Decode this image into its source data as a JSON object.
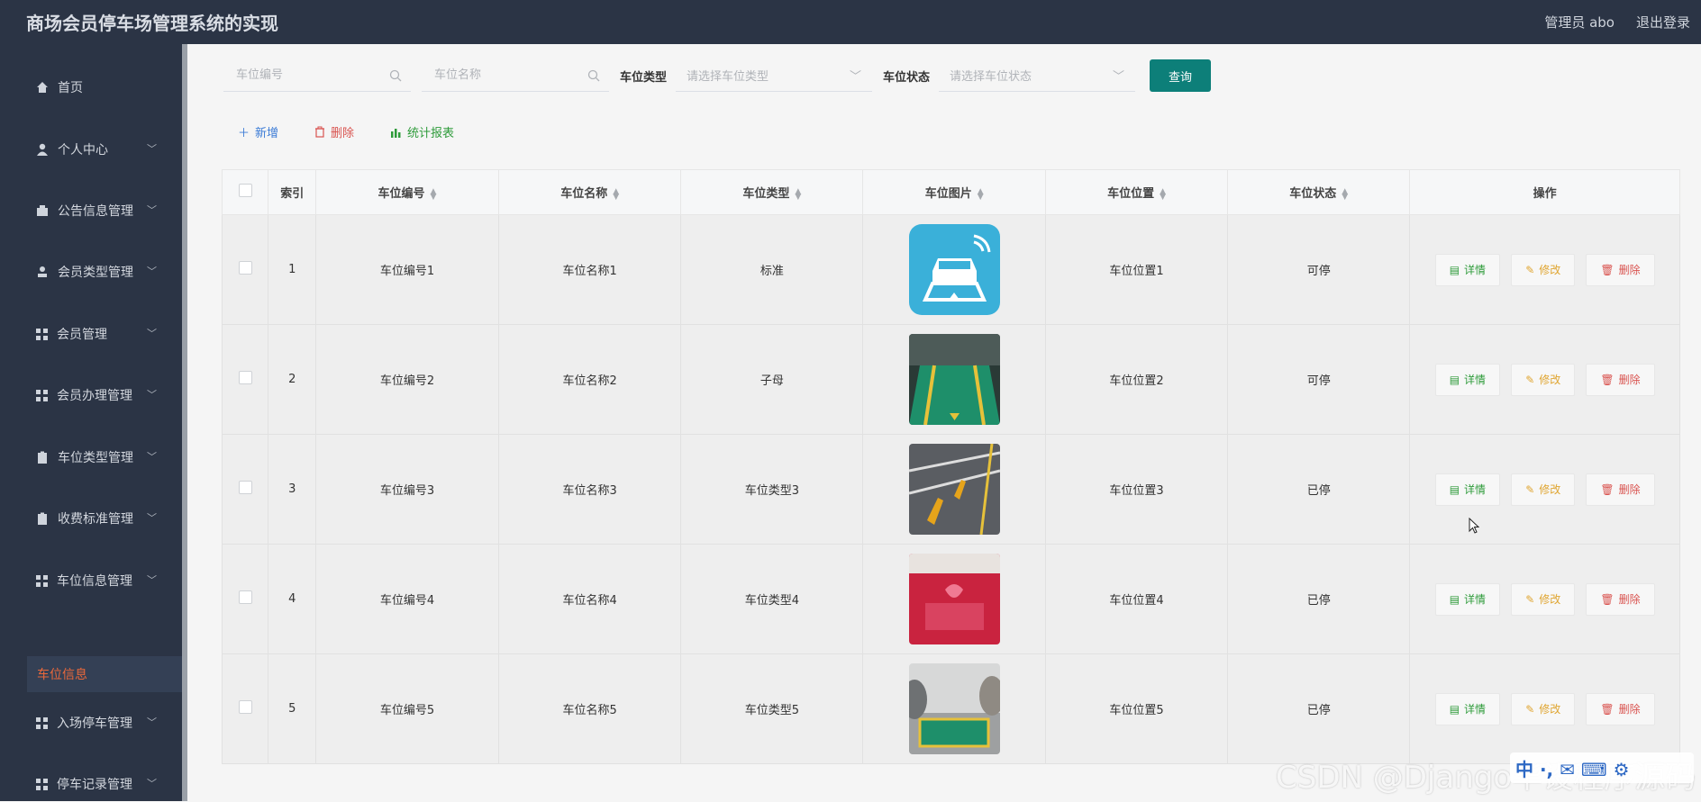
{
  "header": {
    "title": "商场会员停车场管理系统的实现",
    "user": "管理员 abo",
    "logout": "退出登录"
  },
  "sidebar": {
    "items": [
      {
        "label": "首页",
        "icon": "home-icon"
      },
      {
        "label": "个人中心",
        "icon": "user-icon"
      },
      {
        "label": "公告信息管理",
        "icon": "notice-icon"
      },
      {
        "label": "会员类型管理",
        "icon": "member-icon"
      },
      {
        "label": "会员管理",
        "icon": "grid-icon"
      },
      {
        "label": "会员办理管理",
        "icon": "grid-icon"
      },
      {
        "label": "车位类型管理",
        "icon": "clipboard-icon"
      },
      {
        "label": "收费标准管理",
        "icon": "clipboard-icon"
      },
      {
        "label": "车位信息管理",
        "icon": "grid-icon"
      },
      {
        "label": "入场停车管理",
        "icon": "grid-icon"
      },
      {
        "label": "停车记录管理",
        "icon": "grid-icon"
      }
    ],
    "active_sub": "车位信息"
  },
  "search": {
    "code_placeholder": "车位编号",
    "name_placeholder": "车位名称",
    "type_label": "车位类型",
    "type_placeholder": "请选择车位类型",
    "status_label": "车位状态",
    "status_placeholder": "请选择车位状态",
    "query": "查询"
  },
  "actions": {
    "add": "新增",
    "delete": "删除",
    "stats": "统计报表"
  },
  "table": {
    "columns": [
      "索引",
      "车位编号",
      "车位名称",
      "车位类型",
      "车位图片",
      "车位位置",
      "车位状态",
      "操作"
    ],
    "ops": {
      "detail": "详情",
      "edit": "修改",
      "delete": "删除"
    },
    "rows": [
      {
        "index": "1",
        "code": "车位编号1",
        "name": "车位名称1",
        "type": "标准",
        "pos": "车位位置1",
        "status": "可停"
      },
      {
        "index": "2",
        "code": "车位编号2",
        "name": "车位名称2",
        "type": "子母",
        "pos": "车位位置2",
        "status": "可停"
      },
      {
        "index": "3",
        "code": "车位编号3",
        "name": "车位名称3",
        "type": "车位类型3",
        "pos": "车位位置3",
        "status": "已停"
      },
      {
        "index": "4",
        "code": "车位编号4",
        "name": "车位名称4",
        "type": "车位类型4",
        "pos": "车位位置4",
        "status": "已停"
      },
      {
        "index": "5",
        "code": "车位编号5",
        "name": "车位名称5",
        "type": "车位类型5",
        "pos": "车位位置5",
        "status": "已停"
      }
    ]
  },
  "overlay": {
    "watermark": "CSDN @Django毕设程序源码",
    "ime": "中 ·, ✉ ⌨ ⚙"
  },
  "colors": {
    "sidebar": "#2b3445",
    "accent": "#0d7f79",
    "active": "#e9683b"
  }
}
